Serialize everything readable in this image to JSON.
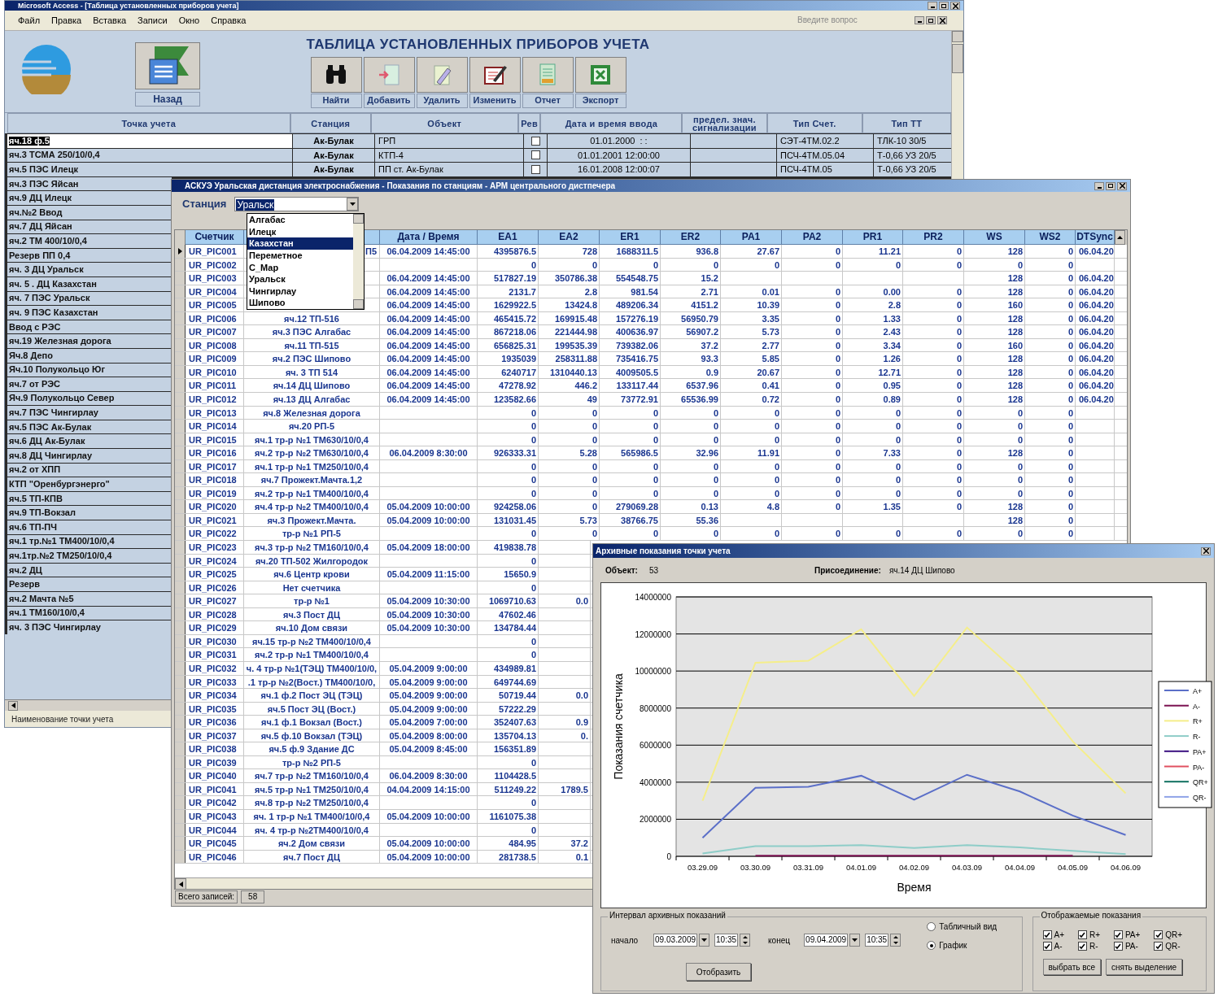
{
  "access_window": {
    "title": "Microsoft Access - [Таблица установленных приборов учета]",
    "menu": [
      "Файл",
      "Правка",
      "Вставка",
      "Записи",
      "Окно",
      "Справка"
    ],
    "help_placeholder": "Введите вопрос",
    "form_title": "ТАБЛИЦА УСТАНОВЛЕННЫХ ПРИБОРОВ УЧЕТА",
    "back_button": "Назад",
    "toolbar": [
      {
        "kind": "find",
        "label": "Найти"
      },
      {
        "kind": "add",
        "label": "Добавить"
      },
      {
        "kind": "delete",
        "label": "Удалить"
      },
      {
        "kind": "edit",
        "label": "Изменить"
      },
      {
        "kind": "report",
        "label": "Отчет"
      },
      {
        "kind": "export",
        "label": "Экспорт"
      }
    ],
    "columns": [
      "Точка учета",
      "Станция",
      "Объект",
      "Рев",
      "Дата и время ввода",
      "предел. знач. сигнализации",
      "Тип Счет.",
      "Тип ТТ"
    ],
    "rows": [
      {
        "point": "яч.18 ф.5",
        "station": "Ак-Булак",
        "object": "ГРП",
        "rev": false,
        "entered": "01.01.2000  : :",
        "meter_type": "СЭТ-4ТМ.02.2",
        "ct_type": "ТЛК-10 30/5",
        "selected": true
      },
      {
        "point": "яч.3  ТСМА 250/10/0,4",
        "station": "Ак-Булак",
        "object": "КТП-4",
        "rev": false,
        "entered": "01.01.2001 12:00:00",
        "meter_type": "ПСЧ-4ТМ.05.04",
        "ct_type": "Т-0,66 УЗ 20/5",
        "selected": false
      },
      {
        "point": "яч.5 ПЭС Илецк",
        "station": "Ак-Булак",
        "object": "ПП ст. Ак-Булак",
        "rev": false,
        "entered": "16.01.2008 12:00:07",
        "meter_type": "ПСЧ-4ТМ.05",
        "ct_type": "Т-0,66 УЗ 20/5",
        "selected": false
      },
      {
        "point": "яч.3 ПЭС Яйсан",
        "selected": false
      },
      {
        "point": "яч.9 ДЦ Илецк",
        "selected": false
      },
      {
        "point": "яч.№2 Ввод",
        "selected": false
      },
      {
        "point": "яч.7 ДЦ Яйсан",
        "selected": false
      },
      {
        "point": "яч.2  ТМ 400/10/0,4",
        "selected": false
      },
      {
        "point": "Резерв ПП 0,4",
        "selected": false
      },
      {
        "point": "яч. 3  ДЦ Уральск",
        "selected": false
      },
      {
        "point": "яч. 5  . ДЦ Казахстан",
        "selected": false
      },
      {
        "point": "яч. 7  ПЭС Уральск",
        "selected": false
      },
      {
        "point": "яч. 9  ПЭС Казахстан",
        "selected": false
      },
      {
        "point": "Ввод с РЭС",
        "selected": false
      },
      {
        "point": "яч.19 Железная дорога",
        "selected": false
      },
      {
        "point": "Яч.8 Депо",
        "selected": false
      },
      {
        "point": "Яч.10 Полукольцо Юг",
        "selected": false
      },
      {
        "point": "яч.7  от РЭС",
        "selected": false
      },
      {
        "point": "Яч.9 Полукольцо Север",
        "selected": false
      },
      {
        "point": "яч.7 ПЭС Чингирлау",
        "selected": false
      },
      {
        "point": "яч.5 ПЭС Ак-Булак",
        "selected": false
      },
      {
        "point": "яч.6 ДЦ Ак-Булак",
        "selected": false
      },
      {
        "point": "яч.8 ДЦ Чингирлау",
        "selected": false
      },
      {
        "point": "яч.2  от ХПП",
        "selected": false
      },
      {
        "point": "КТП \"Оренбургэнерго\"",
        "selected": false
      },
      {
        "point": "яч.5  ТП-КПВ",
        "selected": false
      },
      {
        "point": "яч.9  ТП-Вокзал",
        "selected": false
      },
      {
        "point": "яч.6  ТП-ПЧ",
        "selected": false
      },
      {
        "point": "яч.1 тр.№1 ТМ400/10/0,4",
        "selected": false
      },
      {
        "point": "яч.1тр.№2 ТМ250/10/0,4",
        "selected": false
      },
      {
        "point": "яч.2  ДЦ",
        "selected": false
      },
      {
        "point": "Резерв",
        "selected": false
      },
      {
        "point": "яч.2  Мачта №5",
        "selected": false
      },
      {
        "point": "яч.1  ТМ160/10/0,4",
        "selected": false
      },
      {
        "point": "яч. 3  ПЭС Чингирлау",
        "selected": false
      }
    ],
    "status_bar": "Наименование точки учета"
  },
  "readings_window": {
    "title": "АСКУЭ Уральская дистанция электроснабжения  - Показания по станциям - АРМ центрального дистпечера",
    "station_label": "Станция",
    "station_value": "Уральск",
    "station_options": [
      {
        "label": "Алгабас",
        "selected": false
      },
      {
        "label": "Илецк",
        "selected": false
      },
      {
        "label": "Казахстан",
        "selected": true
      },
      {
        "label": "Переметное",
        "selected": false
      },
      {
        "label": "С_Мар",
        "selected": false
      },
      {
        "label": "Уральск",
        "selected": false
      },
      {
        "label": "Чингирлау",
        "selected": false
      },
      {
        "label": "Шипово",
        "selected": false
      }
    ],
    "columns": [
      "Счетчик",
      "",
      "Дата / Время",
      "EA1",
      "EA2",
      "ER1",
      "ER2",
      "PA1",
      "PA2",
      "PR1",
      "PR2",
      "WS",
      "WS2",
      "DTSync"
    ],
    "rows": [
      {
        "selected": true,
        "cells": [
          "UR_PIC001",
          "П5",
          "06.04.2009 14:45:00",
          "4395876.5",
          "728",
          "1688311.5",
          "936.8",
          "27.67",
          "0",
          "11.21",
          "0",
          "128",
          "0",
          "06.04.20"
        ]
      },
      {
        "selected": false,
        "cells": [
          "UR_PIC002",
          "",
          "",
          "0",
          "0",
          "0",
          "0",
          "0",
          "0",
          "0",
          "0",
          "0",
          "0",
          ""
        ]
      },
      {
        "selected": false,
        "cells": [
          "UR_PIC003",
          "",
          "06.04.2009 14:45:00",
          "517827.19",
          "350786.38",
          "554548.75",
          "15.2",
          "",
          "",
          "",
          "",
          "128",
          "0",
          "06.04.20"
        ]
      },
      {
        "selected": false,
        "cells": [
          "UR_PIC004",
          "",
          "06.04.2009 14:45:00",
          "2131.7",
          "2.8",
          "981.54",
          "2.71",
          "0.01",
          "0",
          "0.00",
          "0",
          "128",
          "0",
          "06.04.20"
        ]
      },
      {
        "selected": false,
        "cells": [
          "UR_PIC005",
          "",
          "06.04.2009 14:45:00",
          "1629922.5",
          "13424.8",
          "489206.34",
          "4151.2",
          "10.39",
          "0",
          "2.8",
          "0",
          "160",
          "0",
          "06.04.20"
        ]
      },
      {
        "selected": false,
        "cells": [
          "UR_PIC006",
          "яч.12  ТП-516",
          "06.04.2009 14:45:00",
          "465415.72",
          "169915.48",
          "157276.19",
          "56950.79",
          "3.35",
          "0",
          "1.33",
          "0",
          "128",
          "0",
          "06.04.20"
        ]
      },
      {
        "selected": false,
        "cells": [
          "UR_PIC007",
          "яч.3  ПЭС Алгабас",
          "06.04.2009 14:45:00",
          "867218.06",
          "221444.98",
          "400636.97",
          "56907.2",
          "5.73",
          "0",
          "2.43",
          "0",
          "128",
          "0",
          "06.04.20"
        ]
      },
      {
        "selected": false,
        "cells": [
          "UR_PIC008",
          "яч.11 ТП-515",
          "06.04.2009 14:45:00",
          "656825.31",
          "199535.39",
          "739382.06",
          "37.2",
          "2.77",
          "0",
          "3.34",
          "0",
          "160",
          "0",
          "06.04.20"
        ]
      },
      {
        "selected": false,
        "cells": [
          "UR_PIC009",
          "яч.2 ПЭС Шипово",
          "06.04.2009 14:45:00",
          "1935039",
          "258311.88",
          "735416.75",
          "93.3",
          "5.85",
          "0",
          "1.26",
          "0",
          "128",
          "0",
          "06.04.20"
        ]
      },
      {
        "selected": false,
        "cells": [
          "UR_PIC010",
          "яч. 3 ТП 514",
          "06.04.2009 14:45:00",
          "6240717",
          "1310440.13",
          "4009505.5",
          "0.9",
          "20.67",
          "0",
          "12.71",
          "0",
          "128",
          "0",
          "06.04.20"
        ]
      },
      {
        "selected": false,
        "cells": [
          "UR_PIC011",
          "яч.14 ДЦ Шипово",
          "06.04.2009 14:45:00",
          "47278.92",
          "446.2",
          "133117.44",
          "6537.96",
          "0.41",
          "0",
          "0.95",
          "0",
          "128",
          "0",
          "06.04.20"
        ]
      },
      {
        "selected": false,
        "cells": [
          "UR_PIC012",
          "яч.13 ДЦ Алгабас",
          "06.04.2009 14:45:00",
          "123582.66",
          "49",
          "73772.91",
          "65536.99",
          "0.72",
          "0",
          "0.89",
          "0",
          "128",
          "0",
          "06.04.20"
        ]
      },
      {
        "selected": false,
        "cells": [
          "UR_PIC013",
          "яч.8 Железная дорога",
          "",
          "0",
          "0",
          "0",
          "0",
          "0",
          "0",
          "0",
          "0",
          "0",
          "0",
          ""
        ]
      },
      {
        "selected": false,
        "cells": [
          "UR_PIC014",
          "яч.20 РП-5",
          "",
          "0",
          "0",
          "0",
          "0",
          "0",
          "0",
          "0",
          "0",
          "0",
          "0",
          ""
        ]
      },
      {
        "selected": false,
        "cells": [
          "UR_PIC015",
          "яч.1 тр-р №1 ТМ630/10/0,4",
          "",
          "0",
          "0",
          "0",
          "0",
          "0",
          "0",
          "0",
          "0",
          "0",
          "0",
          ""
        ]
      },
      {
        "selected": false,
        "cells": [
          "UR_PIC016",
          "яч.2 тр-р №2 ТМ630/10/0,4",
          "06.04.2009 8:30:00",
          "926333.31",
          "5.28",
          "565986.5",
          "32.96",
          "11.91",
          "0",
          "7.33",
          "0",
          "128",
          "0",
          ""
        ]
      },
      {
        "selected": false,
        "cells": [
          "UR_PIC017",
          "яч.1  тр-р №1 ТМ250/10/0,4",
          "",
          "0",
          "0",
          "0",
          "0",
          "0",
          "0",
          "0",
          "0",
          "0",
          "0",
          ""
        ]
      },
      {
        "selected": false,
        "cells": [
          "UR_PIC018",
          "яч.7  Прожект.Мачта.1,2",
          "",
          "0",
          "0",
          "0",
          "0",
          "0",
          "0",
          "0",
          "0",
          "0",
          "0",
          ""
        ]
      },
      {
        "selected": false,
        "cells": [
          "UR_PIC019",
          "яч.2  тр-р №1 ТМ400/10/0,4",
          "",
          "0",
          "0",
          "0",
          "0",
          "0",
          "0",
          "0",
          "0",
          "0",
          "0",
          ""
        ]
      },
      {
        "selected": false,
        "cells": [
          "UR_PIC020",
          "яч.4 тр-р №2  ТМ400/10/0,4",
          "05.04.2009 10:00:00",
          "924258.06",
          "0",
          "279069.28",
          "0.13",
          "4.8",
          "0",
          "1.35",
          "0",
          "128",
          "0",
          ""
        ]
      },
      {
        "selected": false,
        "cells": [
          "UR_PIC021",
          "яч.3  Прожект.Мачта.",
          "05.04.2009 10:00:00",
          "131031.45",
          "5.73",
          "38766.75",
          "55.36",
          "",
          "",
          "",
          "",
          "128",
          "0",
          ""
        ]
      },
      {
        "selected": false,
        "cells": [
          "UR_PIC022",
          "тр-р №1 РП-5",
          "",
          "0",
          "0",
          "0",
          "0",
          "0",
          "0",
          "0",
          "0",
          "0",
          "0",
          ""
        ]
      },
      {
        "selected": false,
        "cells": [
          "UR_PIC023",
          "яч.3  тр-р №2 ТМ160/10/0,4",
          "05.04.2009 18:00:00",
          "419838.78",
          ""
        ]
      },
      {
        "selected": false,
        "cells": [
          "UR_PIC024",
          "яч.20 ТП-502 Жилгородок",
          "",
          "0",
          ""
        ]
      },
      {
        "selected": false,
        "cells": [
          "UR_PIC025",
          "яч.6 Центр крови",
          "05.04.2009 11:15:00",
          "15650.9",
          ""
        ]
      },
      {
        "selected": false,
        "cells": [
          "UR_PIC026",
          "Нет счетчика",
          "",
          "0",
          ""
        ]
      },
      {
        "selected": false,
        "cells": [
          "UR_PIC027",
          "тр-р №1",
          "05.04.2009 10:30:00",
          "1069710.63",
          "0.0"
        ]
      },
      {
        "selected": false,
        "cells": [
          "UR_PIC028",
          "яч.3  Пост ДЦ",
          "05.04.2009 10:30:00",
          "47602.46",
          ""
        ]
      },
      {
        "selected": false,
        "cells": [
          "UR_PIC029",
          "яч.10  Дом связи",
          "05.04.2009 10:30:00",
          "134784.44",
          ""
        ]
      },
      {
        "selected": false,
        "cells": [
          "UR_PIC030",
          "яч.15 тр-р №2 ТМ400/10/0,4",
          "",
          "0",
          ""
        ]
      },
      {
        "selected": false,
        "cells": [
          "UR_PIC031",
          "яч.2 тр-р №1 ТМ400/10/0,4",
          "",
          "0",
          ""
        ]
      },
      {
        "selected": false,
        "cells": [
          "UR_PIC032",
          "ч. 4 тр-р №1(ТЭЦ) ТМ400/10/0,",
          "05.04.2009 9:00:00",
          "434989.81",
          ""
        ]
      },
      {
        "selected": false,
        "cells": [
          "UR_PIC033",
          ".1 тр-р №2(Вост.)  ТМ400/10/0,",
          "05.04.2009 9:00:00",
          "649744.69",
          ""
        ]
      },
      {
        "selected": false,
        "cells": [
          "UR_PIC034",
          "яч.1 ф.2  Пост ЭЦ (ТЭЦ)",
          "05.04.2009 9:00:00",
          "50719.44",
          "0.0"
        ]
      },
      {
        "selected": false,
        "cells": [
          "UR_PIC035",
          "яч.5  Пост ЭЦ (Вост.)",
          "05.04.2009 9:00:00",
          "57222.29",
          ""
        ]
      },
      {
        "selected": false,
        "cells": [
          "UR_PIC036",
          "яч.1 ф.1  Вокзал (Вост.)",
          "05.04.2009 7:00:00",
          "352407.63",
          "0.9"
        ]
      },
      {
        "selected": false,
        "cells": [
          "UR_PIC037",
          "яч.5 ф.10  Вокзал (ТЭЦ)",
          "05.04.2009 8:00:00",
          "135704.13",
          "0."
        ]
      },
      {
        "selected": false,
        "cells": [
          "UR_PIC038",
          "яч.5 ф.9  Здание ДС",
          "05.04.2009 8:45:00",
          "156351.89",
          ""
        ]
      },
      {
        "selected": false,
        "cells": [
          "UR_PIC039",
          "тр-р №2 РП-5",
          "",
          "0",
          ""
        ]
      },
      {
        "selected": false,
        "cells": [
          "UR_PIC040",
          "яч.7 тр-р №2  ТМ160/10/0,4",
          "06.04.2009 8:30:00",
          "1104428.5",
          ""
        ]
      },
      {
        "selected": false,
        "cells": [
          "UR_PIC041",
          "яч.5 тр-р №1 ТМ250/10/0,4",
          "04.04.2009 14:15:00",
          "511249.22",
          "1789.5"
        ]
      },
      {
        "selected": false,
        "cells": [
          "UR_PIC042",
          "яч.8  тр-р №2 ТМ250/10/0,4",
          "",
          "0",
          ""
        ]
      },
      {
        "selected": false,
        "cells": [
          "UR_PIC043",
          "яч. 1 тр-р №1 ТМ400/10/0,4",
          "05.04.2009 10:00:00",
          "1161075.38",
          ""
        ]
      },
      {
        "selected": false,
        "cells": [
          "UR_PIC044",
          "яч. 4 тр-р №2ТМ400/10/0,4",
          "",
          "0",
          ""
        ]
      },
      {
        "selected": false,
        "cells": [
          "UR_PIC045",
          "яч.2  Дом связи",
          "05.04.2009 10:00:00",
          "484.95",
          "37.2"
        ]
      },
      {
        "selected": false,
        "cells": [
          "UR_PIC046",
          "яч.7  Пост ДЦ",
          "05.04.2009 10:00:00",
          "281738.5",
          "0.1"
        ]
      }
    ],
    "record_count_label": "Всего записей:",
    "record_count": "58"
  },
  "archive_window": {
    "title": "Архивные показания точки учета",
    "object_label": "Объект:",
    "object_value": "53",
    "connection_label": "Присоединение:",
    "connection_value": "яч.14 ДЦ Шипово",
    "chart_data": {
      "type": "line",
      "xlabel": "Время",
      "ylabel": "Показания счетчика",
      "categories": [
        "03.29.09",
        "03.30.09",
        "03.31.09",
        "04.01.09",
        "04.02.09",
        "04.03.09",
        "04.04.09",
        "04.05.09",
        "04.06.09"
      ],
      "ylim": [
        0,
        14000000
      ],
      "yticks": [
        0,
        2000000,
        4000000,
        6000000,
        8000000,
        10000000,
        12000000,
        14000000
      ],
      "series": [
        {
          "name": "A+",
          "color": "#5b6fc8",
          "values": [
            1000000,
            3700000,
            3750000,
            4350000,
            3050000,
            4400000,
            3500000,
            2200000,
            1150000
          ]
        },
        {
          "name": "A-",
          "color": "#7a1050",
          "values": [
            null,
            30000,
            30000,
            30000,
            30000,
            30000,
            30000,
            30000,
            null
          ]
        },
        {
          "name": "R+",
          "color": "#f5ee8a",
          "values": [
            3000000,
            10450000,
            10550000,
            12250000,
            8650000,
            12350000,
            9800000,
            6200000,
            3400000
          ]
        },
        {
          "name": "R-",
          "color": "#8ecdc8",
          "values": [
            150000,
            550000,
            550000,
            600000,
            450000,
            600000,
            480000,
            300000,
            120000
          ]
        },
        {
          "name": "PA+",
          "color": "#3a1080",
          "values": [
            null,
            null,
            null,
            null,
            null,
            null,
            null,
            null,
            null
          ]
        },
        {
          "name": "PA-",
          "color": "#e05060",
          "values": [
            null,
            null,
            null,
            null,
            null,
            null,
            null,
            null,
            null
          ]
        },
        {
          "name": "QR+",
          "color": "#107060",
          "values": [
            null,
            null,
            null,
            null,
            null,
            null,
            null,
            null,
            null
          ]
        },
        {
          "name": "QR-",
          "color": "#8fa3e8",
          "values": [
            null,
            null,
            null,
            null,
            null,
            null,
            null,
            null,
            null
          ]
        }
      ],
      "grid": true,
      "legend": true
    },
    "interval": {
      "title": "Интервал архивных показаний",
      "start_label": "начало",
      "start_date": "09.03.2009",
      "start_time": "10:35",
      "end_label": "конец",
      "end_date": "09.04.2009",
      "end_time": "10:35",
      "show_button": "Отобразить"
    },
    "view_options": [
      {
        "label": "Табличный вид",
        "selected": false
      },
      {
        "label": "График",
        "selected": true
      }
    ],
    "series_group": {
      "title": "Отображаемые показания",
      "checkboxes": [
        {
          "label": "A+",
          "checked": true
        },
        {
          "label": "A-",
          "checked": true
        },
        {
          "label": "R+",
          "checked": true
        },
        {
          "label": "R-",
          "checked": true
        },
        {
          "label": "PA+",
          "checked": true
        },
        {
          "label": "PA-",
          "checked": true
        },
        {
          "label": "QR+",
          "checked": true
        },
        {
          "label": "QR-",
          "checked": true
        }
      ],
      "buttons": [
        "выбрать все",
        "снять выделение"
      ]
    }
  }
}
